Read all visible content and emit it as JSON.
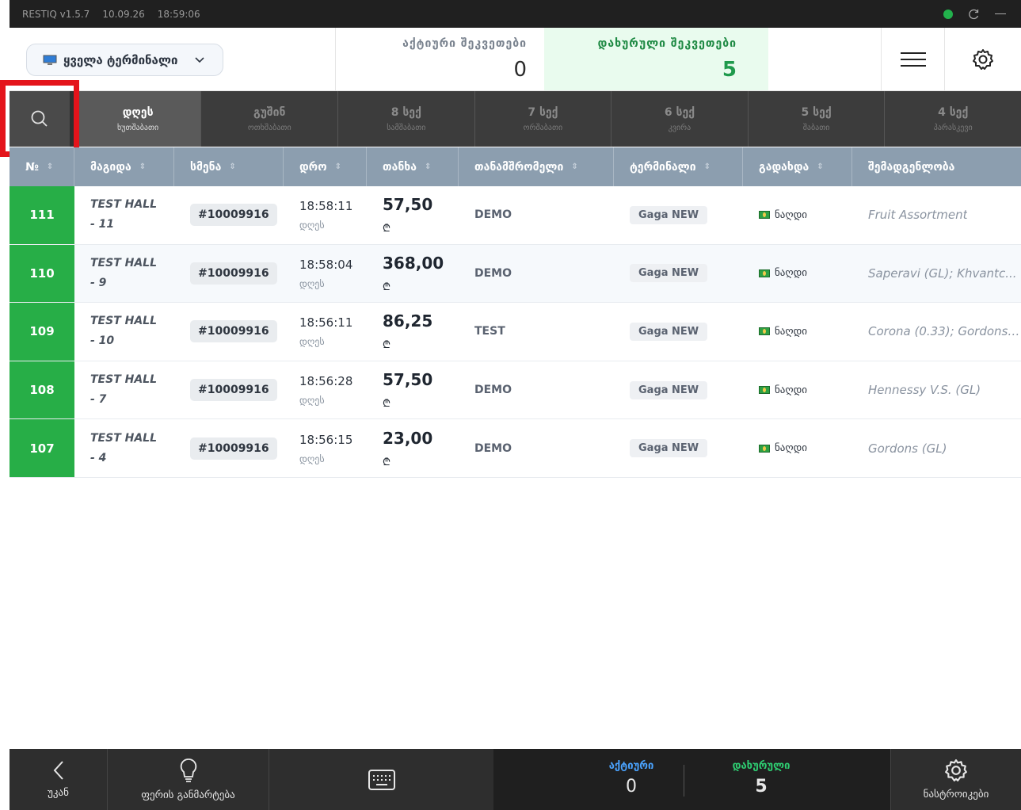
{
  "titlebar": {
    "app": "RESTIQ v1.5.7",
    "date": "10.09.26",
    "time": "18:59:06"
  },
  "header": {
    "terminal_select": "ყველა ტერმინალი",
    "active_label": "აქტიური შეკვეთები",
    "active_count": "0",
    "closed_label": "დახურული შეკვეთები",
    "closed_count": "5"
  },
  "tabs": [
    {
      "day": "დღეს",
      "weekday": "ხუთშაბათი"
    },
    {
      "day": "გუშინ",
      "weekday": "ოთხშაბათი"
    },
    {
      "day": "8 სექ",
      "weekday": "სამშაბათი"
    },
    {
      "day": "7 სექ",
      "weekday": "ორშაბათი"
    },
    {
      "day": "6 სექ",
      "weekday": "კვირა"
    },
    {
      "day": "5 სექ",
      "weekday": "შაბათი"
    },
    {
      "day": "4 სექ",
      "weekday": "პარასკევი"
    }
  ],
  "columns": [
    "№",
    "მაგიდა",
    "სმენა",
    "დრო",
    "თანხა",
    "თანამშრომელი",
    "ტერმინალი",
    "გადახდა",
    "შემადგენლობა"
  ],
  "rows": [
    {
      "no": "111",
      "table1": "TEST HALL",
      "table2": "- 11",
      "shift": "#10009916",
      "time": "18:58:11",
      "day": "დღეს",
      "amount": "57,50",
      "currency": "₾",
      "employee": "DEMO",
      "terminal": "Gaga NEW",
      "payment": "ნაღდი",
      "composition": "Fruit Assortment"
    },
    {
      "no": "110",
      "table1": "TEST HALL",
      "table2": "- 9",
      "shift": "#10009916",
      "time": "18:58:04",
      "day": "დღეს",
      "amount": "368,00",
      "currency": "₾",
      "employee": "DEMO",
      "terminal": "Gaga NEW",
      "payment": "ნაღდი",
      "composition": "Saperavi (GL); Khvantc..."
    },
    {
      "no": "109",
      "table1": "TEST HALL",
      "table2": "- 10",
      "shift": "#10009916",
      "time": "18:56:11",
      "day": "დღეს",
      "amount": "86,25",
      "currency": "₾",
      "employee": "TEST",
      "terminal": "Gaga NEW",
      "payment": "ნაღდი",
      "composition": "Corona (0.33); Gordons ..."
    },
    {
      "no": "108",
      "table1": "TEST HALL",
      "table2": "- 7",
      "shift": "#10009916",
      "time": "18:56:28",
      "day": "დღეს",
      "amount": "57,50",
      "currency": "₾",
      "employee": "DEMO",
      "terminal": "Gaga NEW",
      "payment": "ნაღდი",
      "composition": "Hennessy V.S. (GL)"
    },
    {
      "no": "107",
      "table1": "TEST HALL",
      "table2": "- 4",
      "shift": "#10009916",
      "time": "18:56:15",
      "day": "დღეს",
      "amount": "23,00",
      "currency": "₾",
      "employee": "DEMO",
      "terminal": "Gaga NEW",
      "payment": "ნაღდი",
      "composition": "Gordons (GL)"
    }
  ],
  "bottom": {
    "back": "უკან",
    "color_legend": "ფერის განმარტება",
    "active_label": "აქტიური",
    "active_count": "0",
    "closed_label": "დახურული",
    "closed_count": "5",
    "settings": "ნასტროიკები"
  },
  "colors": {
    "accent_green": "#27ae47",
    "header_blue": "#8c9eaf",
    "highlight_red": "#e4141b"
  }
}
